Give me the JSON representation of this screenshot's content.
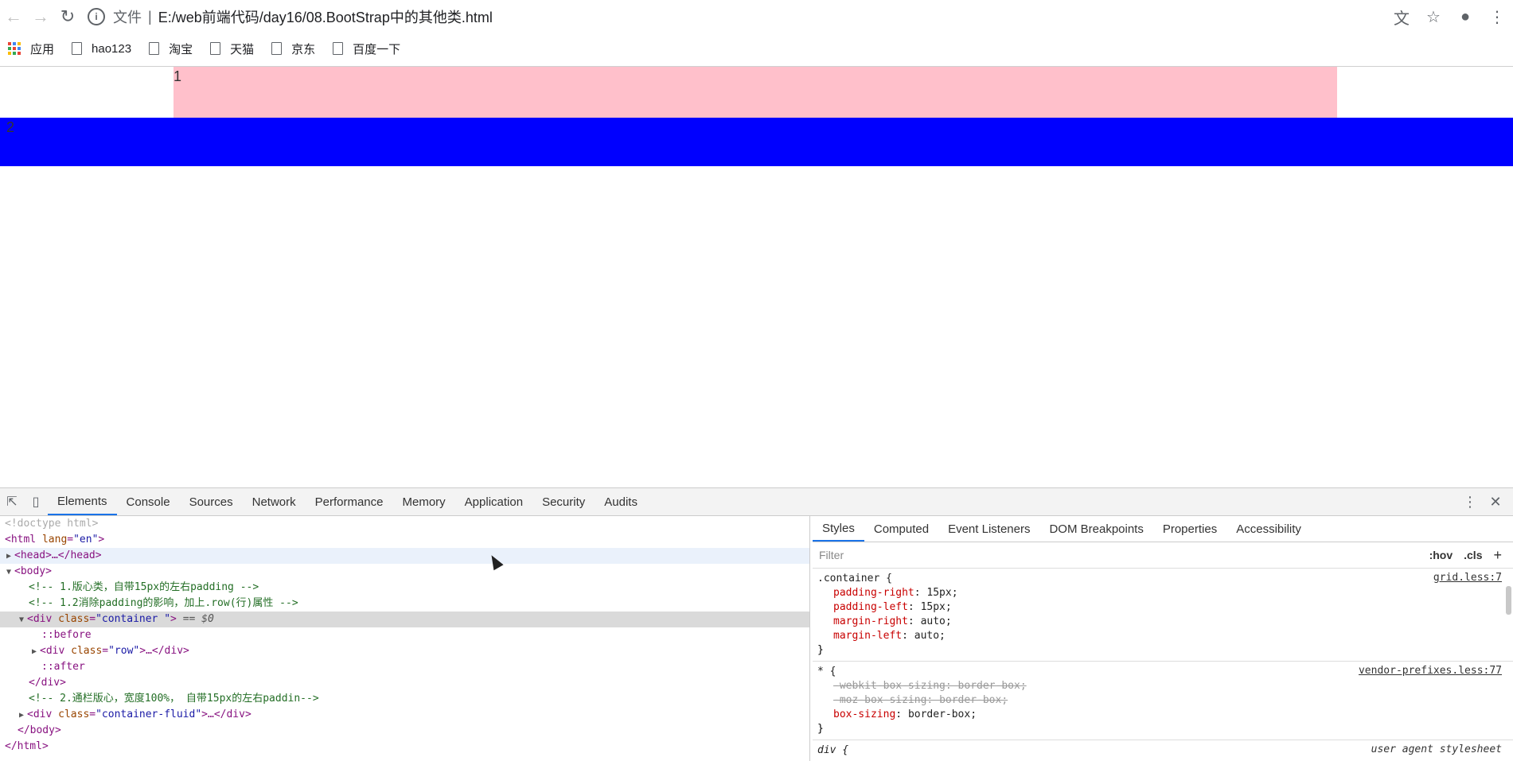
{
  "browser": {
    "address_scheme": "文件",
    "address_separator": "|",
    "address_path": "E:/web前端代码/day16/08.BootStrap中的其他类.html"
  },
  "bookmarks": {
    "apps": "应用",
    "items": [
      "hao123",
      "淘宝",
      "天猫",
      "京东",
      "百度一下"
    ]
  },
  "page": {
    "container_text": "1",
    "fluid_text": "2",
    "container_color": "#ffc0cb",
    "fluid_color": "#0000ff"
  },
  "devtools": {
    "tabs": [
      "Elements",
      "Console",
      "Sources",
      "Network",
      "Performance",
      "Memory",
      "Application",
      "Security",
      "Audits"
    ],
    "active_tab": "Elements",
    "dom": {
      "doctype": "<!doctype html>",
      "html_open_tag": "html",
      "html_attr": "lang",
      "html_val": "\"en\"",
      "head": "<head>…</head>",
      "body_open": "<body>",
      "comment1": "<!-- 1.版心类，自带15px的左右padding -->",
      "comment2": "<!-- 1.2消除padding的影响，加上.row(行)属性 -->",
      "div_tag": "div",
      "div_attr": "class",
      "div_val": "\"container \"",
      "selected_marker": "== $0",
      "before": "::before",
      "row_attr": "class",
      "row_val": "\"row\"",
      "row_rest": ">…</div>",
      "after": "::after",
      "div_close": "</div>",
      "comment3": "<!-- 2.通栏版心，宽度100%， 自带15px的左右paddin-->",
      "fluid_val": "\"container-fluid\"",
      "fluid_rest": ">…</div>",
      "body_close": "</body>",
      "html_close": "</html>"
    },
    "styles_tabs": [
      "Styles",
      "Computed",
      "Event Listeners",
      "DOM Breakpoints",
      "Properties",
      "Accessibility"
    ],
    "filter_placeholder": "Filter",
    "filter_hov": ":hov",
    "filter_cls": ".cls",
    "filter_add": "+",
    "rules": [
      {
        "selector": ".container {",
        "source": "grid.less:7",
        "decls": [
          {
            "prop": "padding-right",
            "value": "15px;"
          },
          {
            "prop": "padding-left",
            "value": "15px;"
          },
          {
            "prop": "margin-right",
            "value": "auto;"
          },
          {
            "prop": "margin-left",
            "value": "auto;"
          }
        ]
      },
      {
        "selector": "* {",
        "source": "vendor-prefixes.less:77",
        "decls": [
          {
            "prop": "-webkit-box-sizing",
            "value": "border-box;"
          },
          {
            "prop": "-moz-box-sizing",
            "value": "border-box;"
          },
          {
            "prop": "box-sizing",
            "value": "border-box;"
          }
        ]
      }
    ],
    "partial_rule": {
      "selector": "div {",
      "source": "user agent stylesheet"
    },
    "close_brace": "}"
  }
}
